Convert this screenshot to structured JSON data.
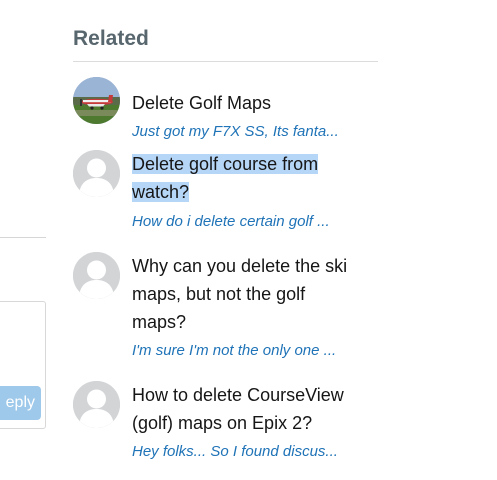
{
  "reply_button_label": "eply",
  "related": {
    "title": "Related",
    "items": [
      {
        "title": "Delete Golf Maps",
        "snippet": "Just got my F7X SS, Its fanta...",
        "avatar": "photo-airplane"
      },
      {
        "title_line1": "Delete golf course from",
        "title_line2": "watch?",
        "snippet": "How do i delete certain golf ...",
        "avatar": "default-user"
      },
      {
        "title_line1": "Why can you delete the ski",
        "title_line2": "maps, but not the golf",
        "title_line3": "maps?",
        "snippet": "I'm sure I'm not the only one ...",
        "avatar": "default-user"
      },
      {
        "title_line1": "How to delete CourseView",
        "title_line2": "(golf) maps on Epix 2?",
        "snippet": "Hey folks... So I found discus...",
        "avatar": "default-user"
      }
    ]
  },
  "colors": {
    "heading": "#58666e",
    "link": "#1f73b7",
    "selection": "#b6d6f7",
    "reply_button": "#9ec9ea"
  }
}
